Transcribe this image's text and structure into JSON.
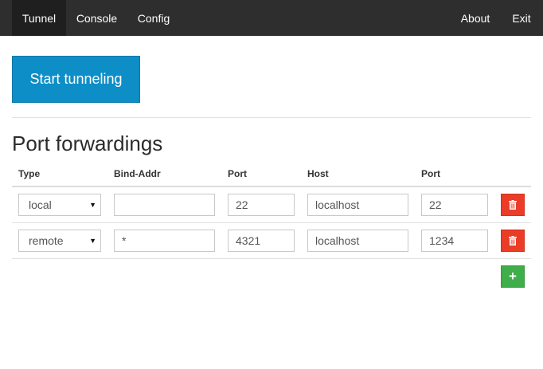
{
  "nav": {
    "tunnel": "Tunnel",
    "console": "Console",
    "config": "Config",
    "about": "About",
    "exit": "Exit"
  },
  "main": {
    "start_button": "Start tunneling",
    "section_title": "Port forwardings",
    "columns": [
      "Type",
      "Bind-Addr",
      "Port",
      "Host",
      "Port"
    ],
    "rows": [
      {
        "type": "local",
        "bind_addr": "",
        "port": "22",
        "host": "localhost",
        "host_port": "22"
      },
      {
        "type": "remote",
        "bind_addr": "*",
        "port": "4321",
        "host": "localhost",
        "host_port": "1234"
      }
    ],
    "add_icon": "plus-icon",
    "delete_icon": "trash-icon"
  },
  "colors": {
    "navbar": "#2e2e2e",
    "primary": "#0d8ec6",
    "danger": "#ea3c26",
    "success": "#3fad4a"
  }
}
